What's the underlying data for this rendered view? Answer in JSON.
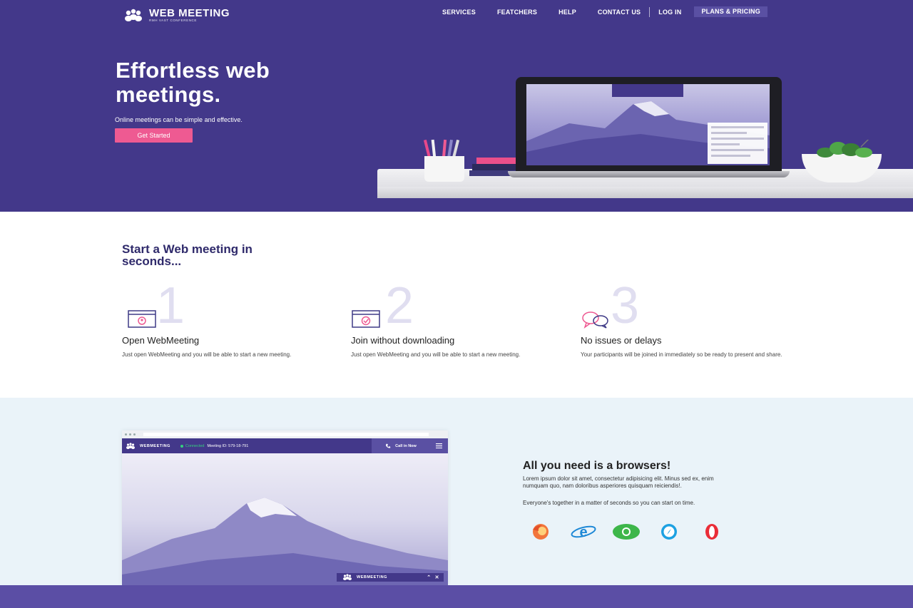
{
  "header": {
    "logo_title": "WEB MEETING",
    "logo_subtitle": "RMH VAST CONFERENCE",
    "nav": [
      "SERVICES",
      "FEATCHERS",
      "HELP",
      "CONTACT US"
    ],
    "login": "LOG IN",
    "plans": "PLANS & PRICING"
  },
  "hero": {
    "title": "Effortless web meetings.",
    "subtitle": "Online meetings can be simple and effective.",
    "cta": "Get Started"
  },
  "steps": {
    "title": "Start a Web meeting in seconds...",
    "items": [
      {
        "number": "1",
        "title": "Open WebMeeting",
        "text": "Just open WebMeeting and you will be able to start a new meeting.",
        "icon": "browser-user-icon"
      },
      {
        "number": "2",
        "title": "Join without downloading",
        "text": "Just open WebMeeting and you will be able to start a new meeting.",
        "icon": "browser-check-icon"
      },
      {
        "number": "3",
        "title": "No issues or delays",
        "text": "Your participants will be joined in immediately so be ready to present and share.",
        "icon": "chat-bubbles-icon"
      }
    ]
  },
  "app_preview": {
    "app_name": "WEBMEETING",
    "status": "Connected",
    "meeting_id": "Meeting ID: 579-18-791",
    "call_label": "Call in Now",
    "mini_name": "WEBMEETING"
  },
  "browsers": {
    "title": "All you need is a browsers!",
    "text1": "Lorem ipsum dolor sit amet, consectetur adipisicing elit. Minus sed ex, enim numquam quo, nam doloribus asperiores quisquam reiciendis!.",
    "text2": "Everyone's together in a matter of seconds so you can start on time.",
    "icons": [
      "firefox-icon",
      "internet-explorer-icon",
      "chrome-icon",
      "safari-icon",
      "opera-icon"
    ]
  },
  "colors": {
    "brand_purple": "#43388a",
    "accent_pink": "#ee5a92",
    "footer_purple": "#5b4ea5",
    "section_bg": "#eaf3f9"
  }
}
